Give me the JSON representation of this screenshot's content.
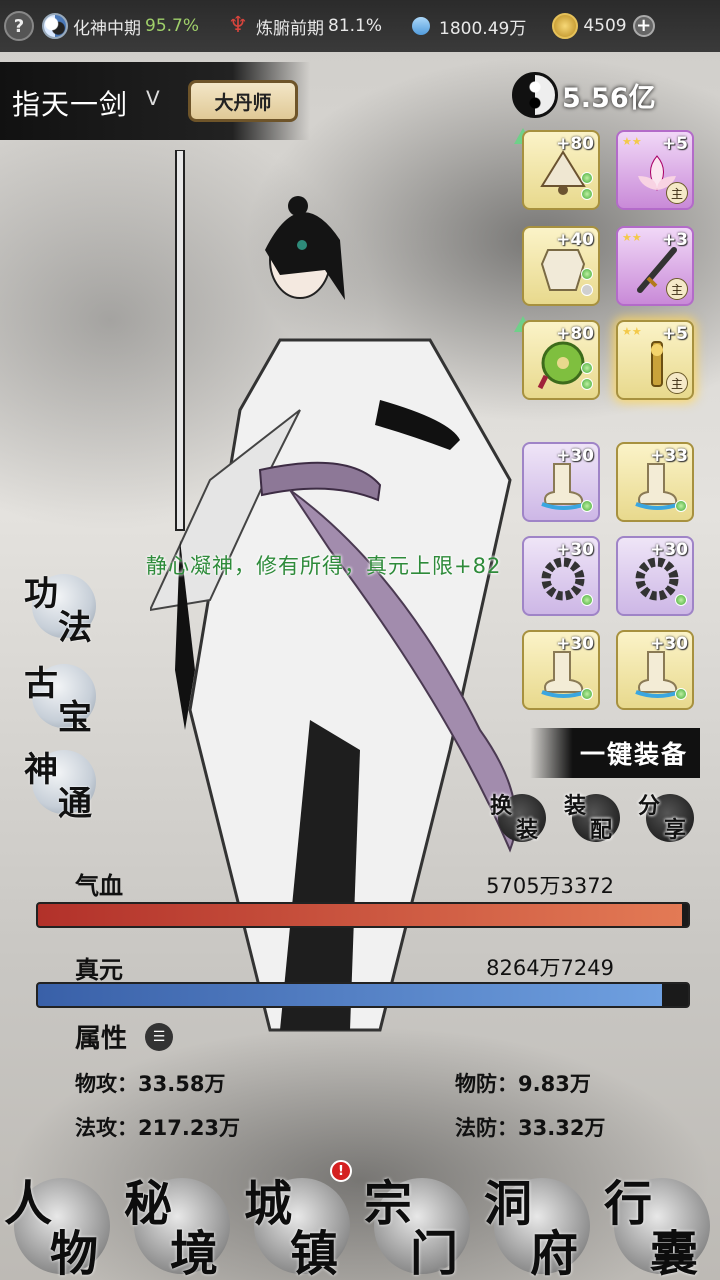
{
  "topbar": {
    "realm_name": "化神中期",
    "realm_pct": "95.7%",
    "body_name": "炼腑前期",
    "body_pct": "81.1%",
    "crystal": "1800.49万",
    "gold": "4509",
    "help_glyph": "?",
    "plus_glyph": "+"
  },
  "player": {
    "name": "指天一剑",
    "name_mark": "ᐯ",
    "title": "大丹师",
    "power": "5.56亿"
  },
  "equipment": {
    "top": [
      {
        "level": "+80",
        "main": ""
      },
      {
        "level": "+5",
        "main": "主"
      },
      {
        "level": "+40",
        "main": ""
      },
      {
        "level": "+3",
        "main": "主"
      },
      {
        "level": "+80",
        "main": ""
      },
      {
        "level": "+5",
        "main": "主"
      }
    ],
    "bottom": [
      {
        "level": "+30"
      },
      {
        "level": "+33"
      },
      {
        "level": "+30"
      },
      {
        "level": "+30"
      },
      {
        "level": "+30"
      },
      {
        "level": "+30"
      }
    ]
  },
  "side_menu": [
    {
      "a": "功",
      "b": "法"
    },
    {
      "a": "古",
      "b": "宝"
    },
    {
      "a": "神",
      "b": "通"
    }
  ],
  "notice": "静心凝神，修有所得，真元上限+82",
  "actions": {
    "equip_all": "一键装备",
    "swap": {
      "a": "换",
      "b": "装"
    },
    "config": {
      "a": "装",
      "b": "配"
    },
    "share": {
      "a": "分",
      "b": "享"
    }
  },
  "stats": {
    "hp_label": "气血",
    "hp_value": "5705万3372",
    "hp_fill": 0.99,
    "mp_label": "真元",
    "mp_value": "8264万7249",
    "mp_fill": 0.96,
    "attr_title": "属性",
    "phys_atk": "物攻：33.58万",
    "phys_def": "物防：9.83万",
    "mag_atk": "法攻：217.23万",
    "mag_def": "法防：33.32万"
  },
  "nav": [
    {
      "a": "人",
      "b": "物"
    },
    {
      "a": "秘",
      "b": "境"
    },
    {
      "a": "城",
      "b": "镇"
    },
    {
      "a": "宗",
      "b": "门"
    },
    {
      "a": "洞",
      "b": "府"
    },
    {
      "a": "行",
      "b": "囊"
    }
  ],
  "nav_badge": "!",
  "colors": {
    "hp": "#c8443a",
    "mp": "#4f7fca",
    "notice": "#2e8b3a"
  }
}
